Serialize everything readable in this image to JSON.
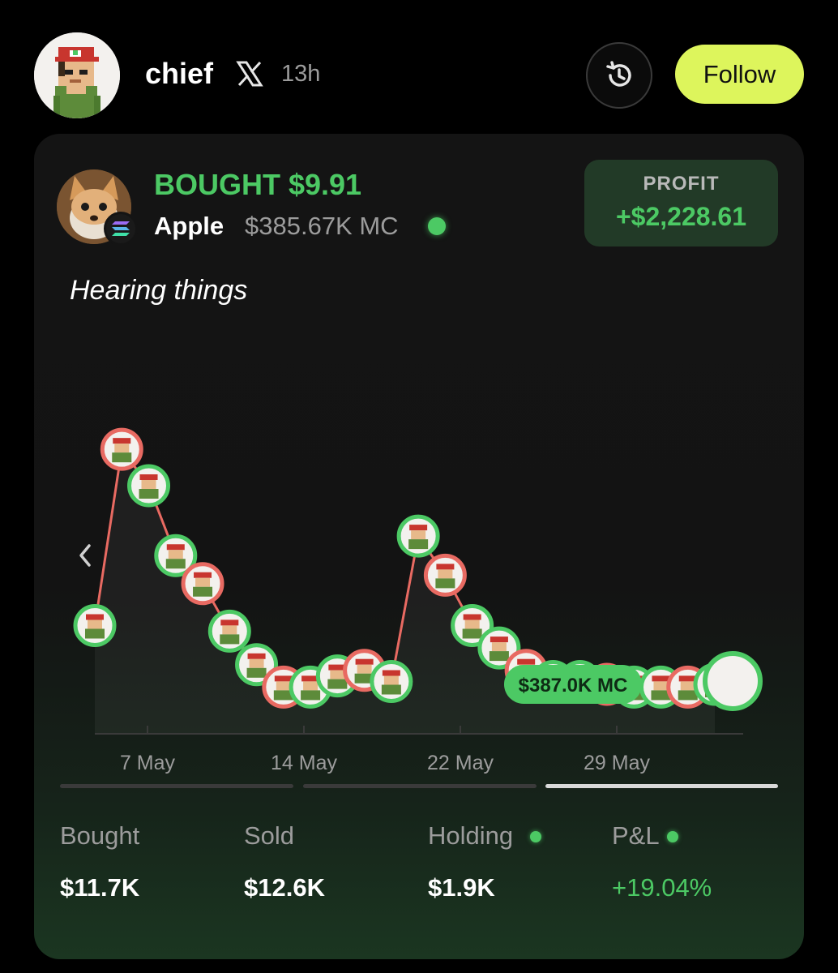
{
  "header": {
    "username": "chief",
    "platform_icon": "x-logo-icon",
    "time_ago": "13h",
    "history_icon": "history-icon",
    "follow_label": "Follow"
  },
  "trade": {
    "title": "BOUGHT $9.91",
    "token_name": "Apple",
    "market_cap": "$385.67K MC",
    "chain_icon": "solana-icon",
    "profit_label": "PROFIT",
    "profit_value": "+$2,228.61",
    "caption": "Hearing things"
  },
  "chart_data": {
    "type": "line",
    "x_tick_labels": [
      "7 May",
      "14 May",
      "22 May",
      "29 May"
    ],
    "current_label": "$387.0K MC",
    "series": [
      {
        "values": [
          0.3,
          0.93,
          0.8,
          0.55,
          0.45,
          0.28,
          0.16,
          0.08,
          0.08,
          0.12,
          0.14,
          0.1,
          0.62,
          0.48,
          0.3,
          0.22,
          0.14,
          0.1,
          0.1,
          0.09,
          0.08,
          0.08,
          0.08,
          0.09
        ]
      }
    ],
    "colors": {
      "line": "#e86a62",
      "buy": "#4cc964",
      "sell": "#e86a62"
    }
  },
  "pager": {
    "count": 3,
    "active": 2
  },
  "stats": [
    {
      "label": "Bought",
      "value": "$11.7K",
      "dot": false,
      "positive": false
    },
    {
      "label": "Sold",
      "value": "$12.6K",
      "dot": false,
      "positive": false
    },
    {
      "label": "Holding",
      "value": "$1.9K",
      "dot": true,
      "positive": false
    },
    {
      "label": "P&L",
      "value": "+19.04%",
      "dot": true,
      "positive": true
    }
  ]
}
